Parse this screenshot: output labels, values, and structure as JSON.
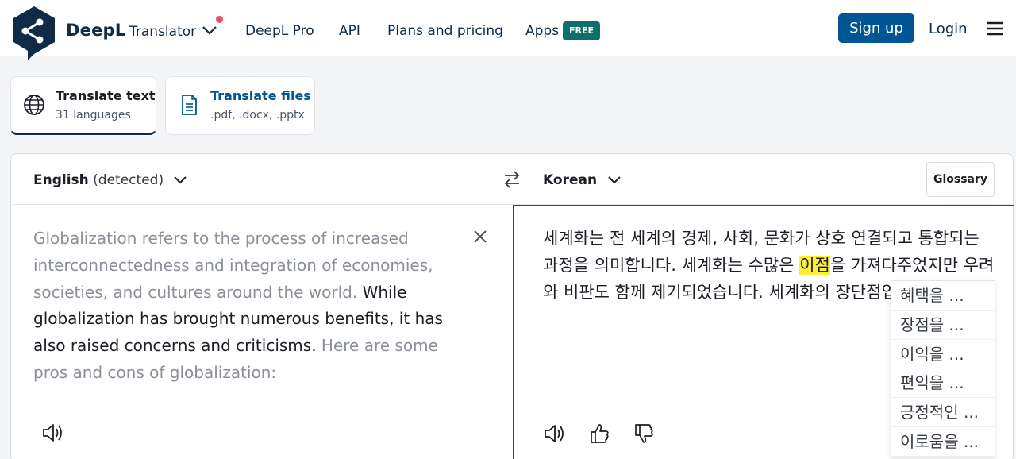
{
  "header": {
    "brand": "DeepL",
    "product": "Translator",
    "nav": [
      "DeepL Pro",
      "API",
      "Plans and pricing",
      "Apps"
    ],
    "free_badge": "FREE",
    "signup": "Sign up",
    "login": "Login"
  },
  "modes": [
    {
      "title": "Translate text",
      "sub": "31 languages",
      "icon": "globe-icon"
    },
    {
      "title": "Translate files",
      "sub": ".pdf, .docx, .pptx",
      "icon": "document-icon"
    }
  ],
  "source": {
    "lang": "English",
    "detected": "(detected)",
    "text_a": "Globalization refers to the process of increased interconnectedness and integration of economies, societies, and cultures around the world. ",
    "text_b": "While globalization has brought numerous benefits, it has also raised concerns and criticisms.",
    "text_c": " Here are some pros and cons of globalization:"
  },
  "target": {
    "lang": "Korean",
    "glossary": "Glossary",
    "text_pre": "세계화는 전 세계의 경제, 사회, 문화가 상호 연결되고 통합되는 과정을 의미합니다. 세계화는 수많은 ",
    "text_highlight": "이점",
    "text_post": "을 가져다주었지만 우려와 비판도 함께 제기되었습니다. 세계화의 장단점입니다:"
  },
  "alternatives": [
    "혜택을 ...",
    "장점을 ...",
    "이익을 ...",
    "편익을 ...",
    "긍정적인 ...",
    "이로움을 ..."
  ],
  "colors": {
    "accent": "#005694",
    "brand": "#0f2b46",
    "highlight": "#fbef3c",
    "free_badge": "#0f6f6a"
  }
}
